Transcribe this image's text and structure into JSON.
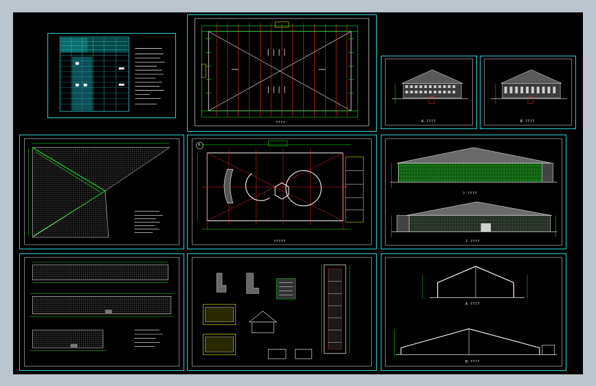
{
  "app": {
    "background_color": "#b9c4cd",
    "canvas_color": "#000000",
    "frame_color": "#2fd3d3"
  },
  "sheets": [
    {
      "id": "s1",
      "content": "cover table / notes"
    },
    {
      "id": "s2",
      "content": "roof plan"
    },
    {
      "id": "s3",
      "content": "elevation small A"
    },
    {
      "id": "s4",
      "content": "elevation small B"
    },
    {
      "id": "s5",
      "content": "roof framing"
    },
    {
      "id": "s6",
      "content": "floor plan"
    },
    {
      "id": "s7",
      "content": "large elevations"
    },
    {
      "id": "s8",
      "content": "wall elevations"
    },
    {
      "id": "s9",
      "content": "details"
    },
    {
      "id": "s10",
      "content": "sections"
    }
  ],
  "captions": {
    "roof_plan": "????",
    "elev_a": "A-????",
    "elev_b": "B-????",
    "floor_plan": "?????",
    "elev_big_a": "?-????",
    "elev_big_b": "?-????",
    "section_a": "A-????",
    "section_b": "B-????",
    "plan_marker": "A"
  }
}
